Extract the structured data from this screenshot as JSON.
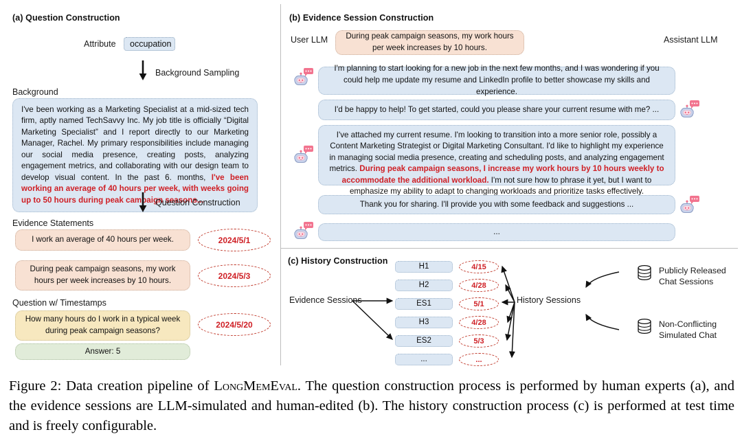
{
  "figure": {
    "caption_prefix": "Figure 2:",
    "caption_part1": " Data creation pipeline of ",
    "caption_benchmark": "LongMemEval",
    "caption_part2": ". The question construction process is performed by human experts (a), and the evidence sessions are LLM-simulated and human-edited (b). The history construction process (c) is performed at test time and is freely configurable."
  },
  "panel_a": {
    "title": "(a) Question Construction",
    "attribute_label": "Attribute",
    "attribute_value": "occupation",
    "arrow1_label": "Background Sampling",
    "background_label": "Background",
    "background_text_normal": "I've been working as a Marketing Specialist at a mid-sized tech firm, aptly named TechSavvy Inc. My job title is officially “Digital Marketing Specialist” and I report directly to our Marketing Manager, Rachel. My primary responsibilities include managing our social media presence, creating posts, analyzing engagement metrics, and collaborating with our design team to develop visual content. In the past 6. months, ",
    "background_text_highlight": "I've been working an average of 40 hours per week, with weeks going up to 50 hours during peak campaign seasons...",
    "arrow2_label": "Question Construction",
    "evidence_label": "Evidence Statements",
    "evidence_statements": [
      {
        "text": "I work an average of 40 hours per week.",
        "date": "2024/5/1"
      },
      {
        "text": "During peak campaign seasons, my work hours per week increases by 10 hours.",
        "date": "2024/5/3"
      }
    ],
    "question_label": "Question w/ Timestamps",
    "question_text": "How many hours do I work in a typical week during peak campaign seasons?",
    "question_date": "2024/5/20",
    "answer_text": "Answer: 5"
  },
  "panel_b": {
    "title": "(b) Evidence Session Construction",
    "user_llm_label": "User LLM",
    "assistant_llm_label": "Assistant LLM",
    "seed_statement": "During peak campaign seasons, my work hours per week increases by 10 hours.",
    "turns": [
      {
        "side": "user",
        "text": "I'm planning to start looking for a new job in the next few months, and I was wondering if you could help me update my resume and LinkedIn profile to better showcase my skills and experience."
      },
      {
        "side": "assistant",
        "text": "I'd be happy to help! To get started, could you please share your current resume with me? ..."
      },
      {
        "side": "user",
        "text_before": "I've attached my current resume. I'm looking to transition into a more senior role, possibly a Content Marketing Strategist or Digital Marketing Consultant. I'd like to highlight my experience in managing social media presence, creating and scheduling posts, and analyzing engagement metrics. ",
        "text_highlight": "During peak campaign seasons, I increase my work hours by 10 hours weekly to accommodate the additional workload.",
        "text_after": " I'm not sure how to phrase it yet, but I want to emphasize my ability to adapt to changing workloads and prioritize tasks effectively."
      },
      {
        "side": "assistant",
        "text": "Thank you for sharing. I'll provide you with some feedback and suggestions ..."
      },
      {
        "side": "user",
        "text": "..."
      }
    ]
  },
  "panel_c": {
    "title": "(c) History Construction",
    "evidence_sessions_label": "Evidence Sessions",
    "history_sessions_label": "History Sessions",
    "sessions": [
      {
        "name": "H1",
        "date": "4/15"
      },
      {
        "name": "H2",
        "date": "4/28"
      },
      {
        "name": "ES1",
        "date": "5/1"
      },
      {
        "name": "H3",
        "date": "4/28"
      },
      {
        "name": "ES2",
        "date": "5/3"
      },
      {
        "name": "...",
        "date": "..."
      }
    ],
    "sources": [
      {
        "line1": "Publicly Released",
        "line2": "Chat Sessions"
      },
      {
        "line1": "Non-Conflicting",
        "line2": "Simulated Chat"
      }
    ]
  },
  "colors": {
    "highlight_red": "#cf2026",
    "bubble_blue": "#dce7f3",
    "bubble_peach": "#f8e1d3",
    "bubble_yellow": "#f7e8bf",
    "bubble_green": "#e1ecd9",
    "date_red": "#c0392b"
  }
}
